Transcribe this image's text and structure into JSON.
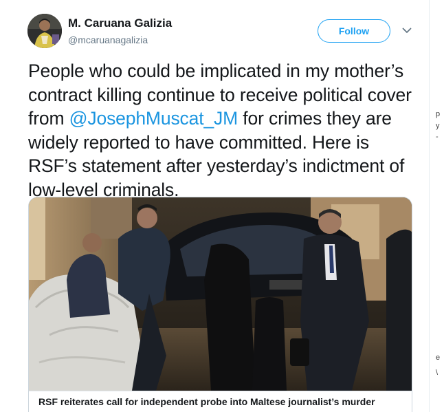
{
  "tweet": {
    "display_name": "M. Caruana Galizia",
    "handle": "@mcaruanagalizia",
    "follow_label": "Follow",
    "text_before": "People who could be implicated in my mother’s contract killing continue to receive political cover from ",
    "mention": "@JosephMuscat_JM",
    "text_after": " for crimes they are widely reported to have committed.  Here is RSF’s statement after yesterday’s indictment of low-level criminals.",
    "card_title": "RSF reiterates call for independent probe into Maltese journalist’s murder"
  },
  "colors": {
    "accent": "#1da1f2",
    "mention": "#1b95e0",
    "text": "#14171a",
    "muted": "#657786",
    "border": "#ccd6dd"
  },
  "icons": {
    "caret": "chevron-down-icon",
    "avatar": "profile-avatar"
  }
}
